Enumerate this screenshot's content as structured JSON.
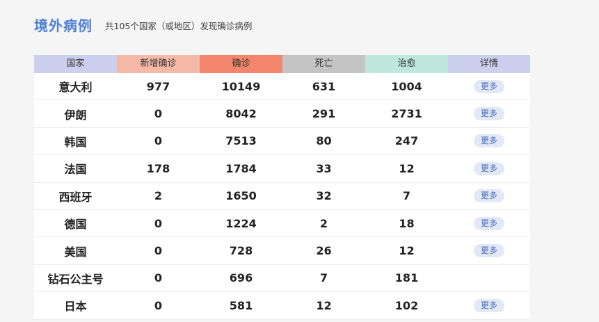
{
  "header": {
    "title": "境外病例",
    "subtitle": "共105个国家（或地区）发现确诊病例"
  },
  "colors": {
    "title": "#4e7fd6",
    "col_country": "#cdcfee",
    "col_new": "#f6b9a8",
    "col_confirmed": "#f2856b",
    "col_dead": "#c4c4c4",
    "col_healed": "#bfe8dd",
    "col_detail": "#cdcfee"
  },
  "table": {
    "headers": [
      "国家",
      "新增确诊",
      "确诊",
      "死亡",
      "治愈",
      "详情"
    ],
    "more_label": "更多",
    "rows": [
      {
        "country": "意大利",
        "new": "977",
        "confirmed": "10149",
        "dead": "631",
        "healed": "1004",
        "has_more": true
      },
      {
        "country": "伊朗",
        "new": "0",
        "confirmed": "8042",
        "dead": "291",
        "healed": "2731",
        "has_more": true
      },
      {
        "country": "韩国",
        "new": "0",
        "confirmed": "7513",
        "dead": "80",
        "healed": "247",
        "has_more": true
      },
      {
        "country": "法国",
        "new": "178",
        "confirmed": "1784",
        "dead": "33",
        "healed": "12",
        "has_more": true
      },
      {
        "country": "西班牙",
        "new": "2",
        "confirmed": "1650",
        "dead": "32",
        "healed": "7",
        "has_more": true
      },
      {
        "country": "德国",
        "new": "0",
        "confirmed": "1224",
        "dead": "2",
        "healed": "18",
        "has_more": true
      },
      {
        "country": "美国",
        "new": "0",
        "confirmed": "728",
        "dead": "26",
        "healed": "12",
        "has_more": true
      },
      {
        "country": "钻石公主号",
        "new": "0",
        "confirmed": "696",
        "dead": "7",
        "healed": "181",
        "has_more": false
      },
      {
        "country": "日本",
        "new": "0",
        "confirmed": "581",
        "dead": "12",
        "healed": "102",
        "has_more": true
      }
    ]
  }
}
